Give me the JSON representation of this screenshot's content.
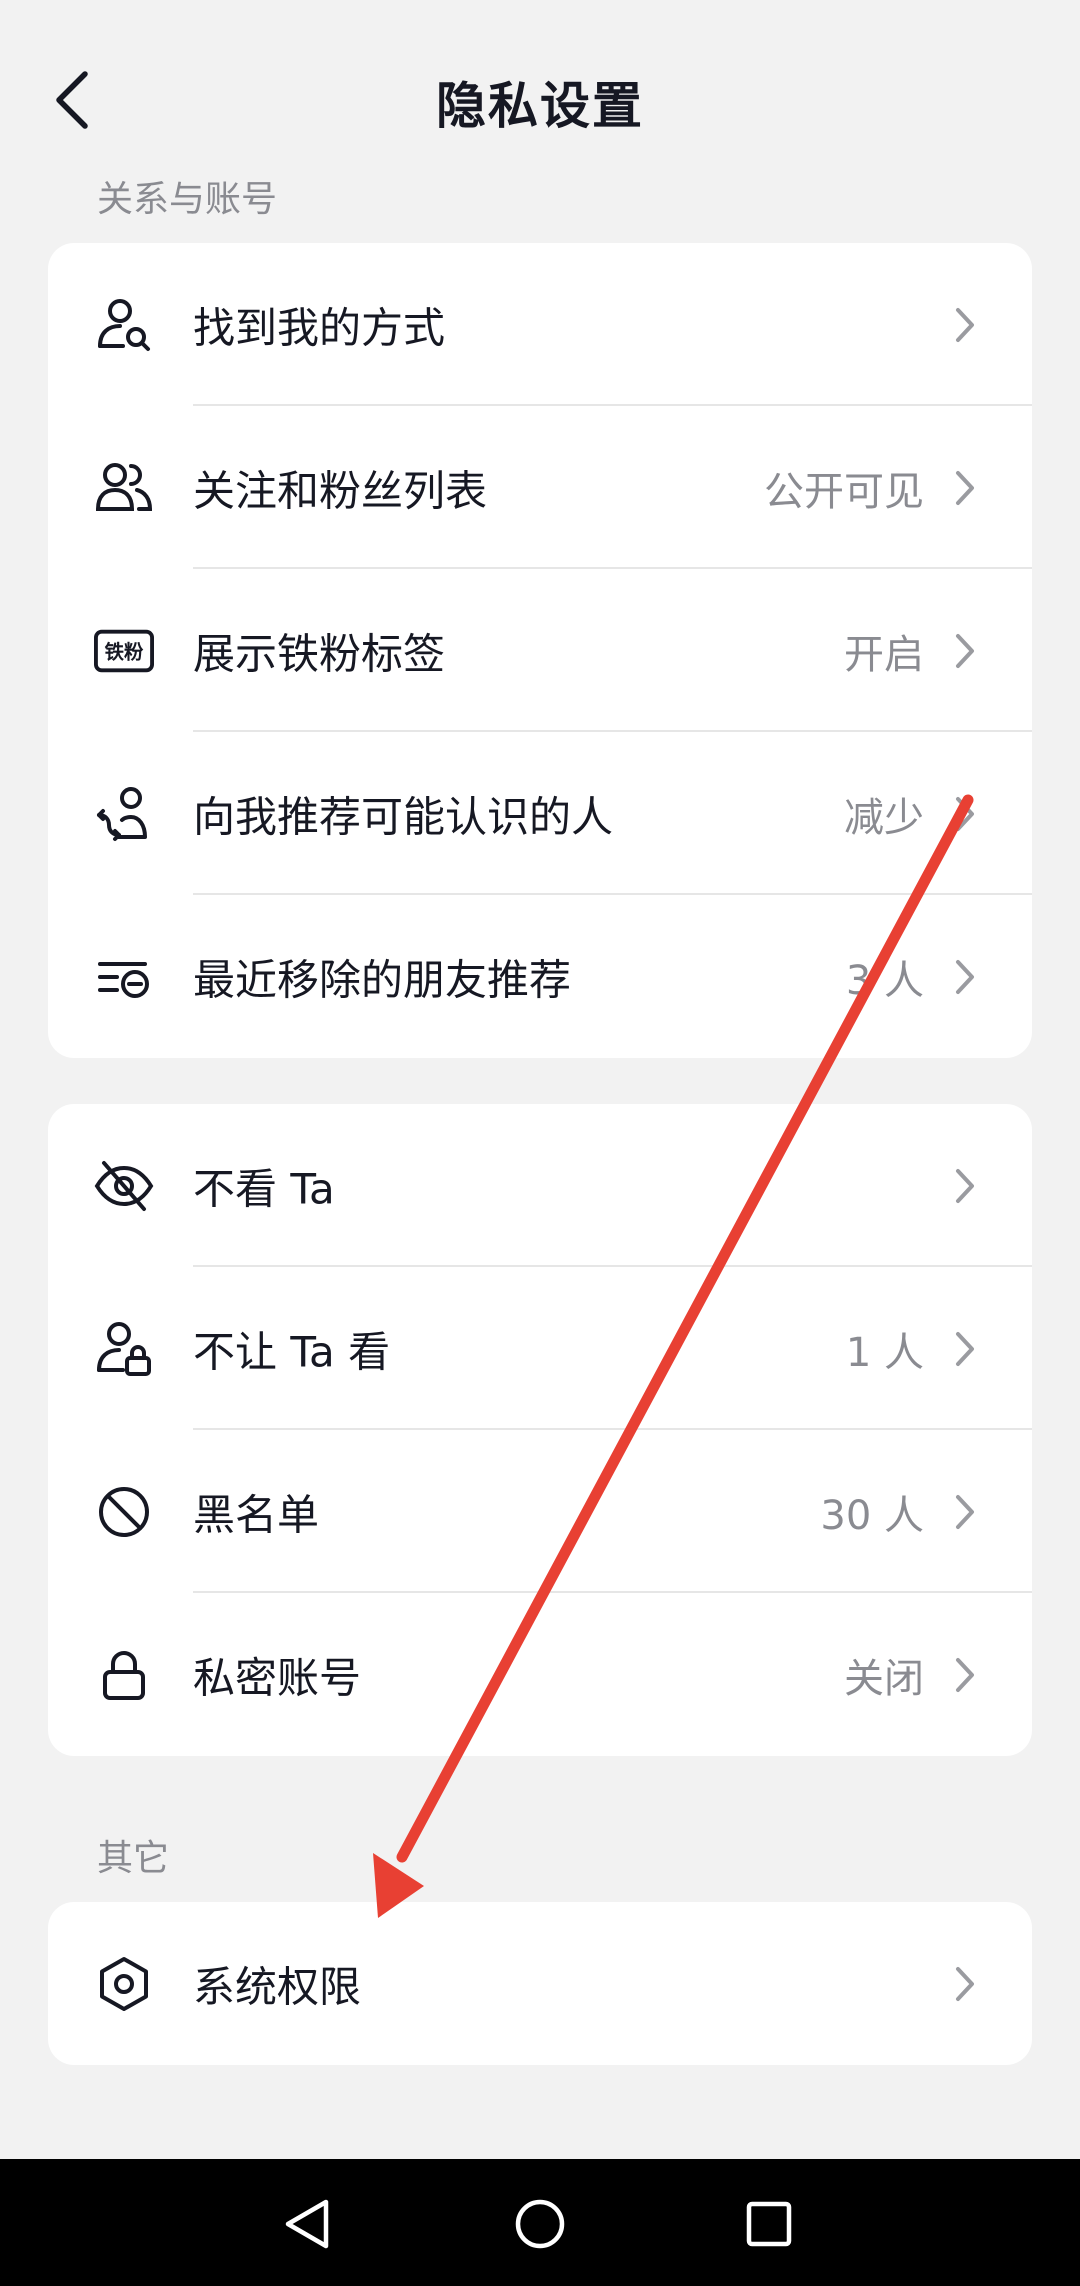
{
  "header": {
    "title": "隐私设置",
    "back_icon": "chevron-left-icon"
  },
  "sections": [
    {
      "label": "关系与账号"
    },
    {
      "label": "其它"
    }
  ],
  "group1": {
    "items": [
      {
        "icon": "person-search-icon",
        "label": "找到我的方式",
        "value": ""
      },
      {
        "icon": "people-icon",
        "label": "关注和粉丝列表",
        "value": "公开可见"
      },
      {
        "icon": "iron-fan-badge-icon",
        "label": "展示铁粉标签",
        "value": "开启",
        "badge_text": "铁粉"
      },
      {
        "icon": "person-recommend-icon",
        "label": "向我推荐可能认识的人",
        "value": "减少"
      },
      {
        "icon": "removed-list-icon",
        "label": "最近移除的朋友推荐",
        "value": "3 人"
      }
    ]
  },
  "group2": {
    "items": [
      {
        "icon": "eye-slash-icon",
        "label": "不看 Ta",
        "value": ""
      },
      {
        "icon": "person-lock-icon",
        "label": "不让 Ta 看",
        "value": "1 人"
      },
      {
        "icon": "block-icon",
        "label": "黑名单",
        "value": "30 人"
      },
      {
        "icon": "lock-icon",
        "label": "私密账号",
        "value": "关闭"
      }
    ]
  },
  "group3": {
    "items": [
      {
        "icon": "hexagon-gear-icon",
        "label": "系统权限",
        "value": ""
      }
    ]
  },
  "navbar": {
    "back_icon": "triangle-back-icon",
    "home_icon": "circle-home-icon",
    "recents_icon": "square-recents-icon"
  },
  "colors": {
    "background": "#f2f2f2",
    "card": "#ffffff",
    "text": "#161823",
    "secondary_text": "#8a8b91",
    "annotation_arrow": "#e84033"
  }
}
